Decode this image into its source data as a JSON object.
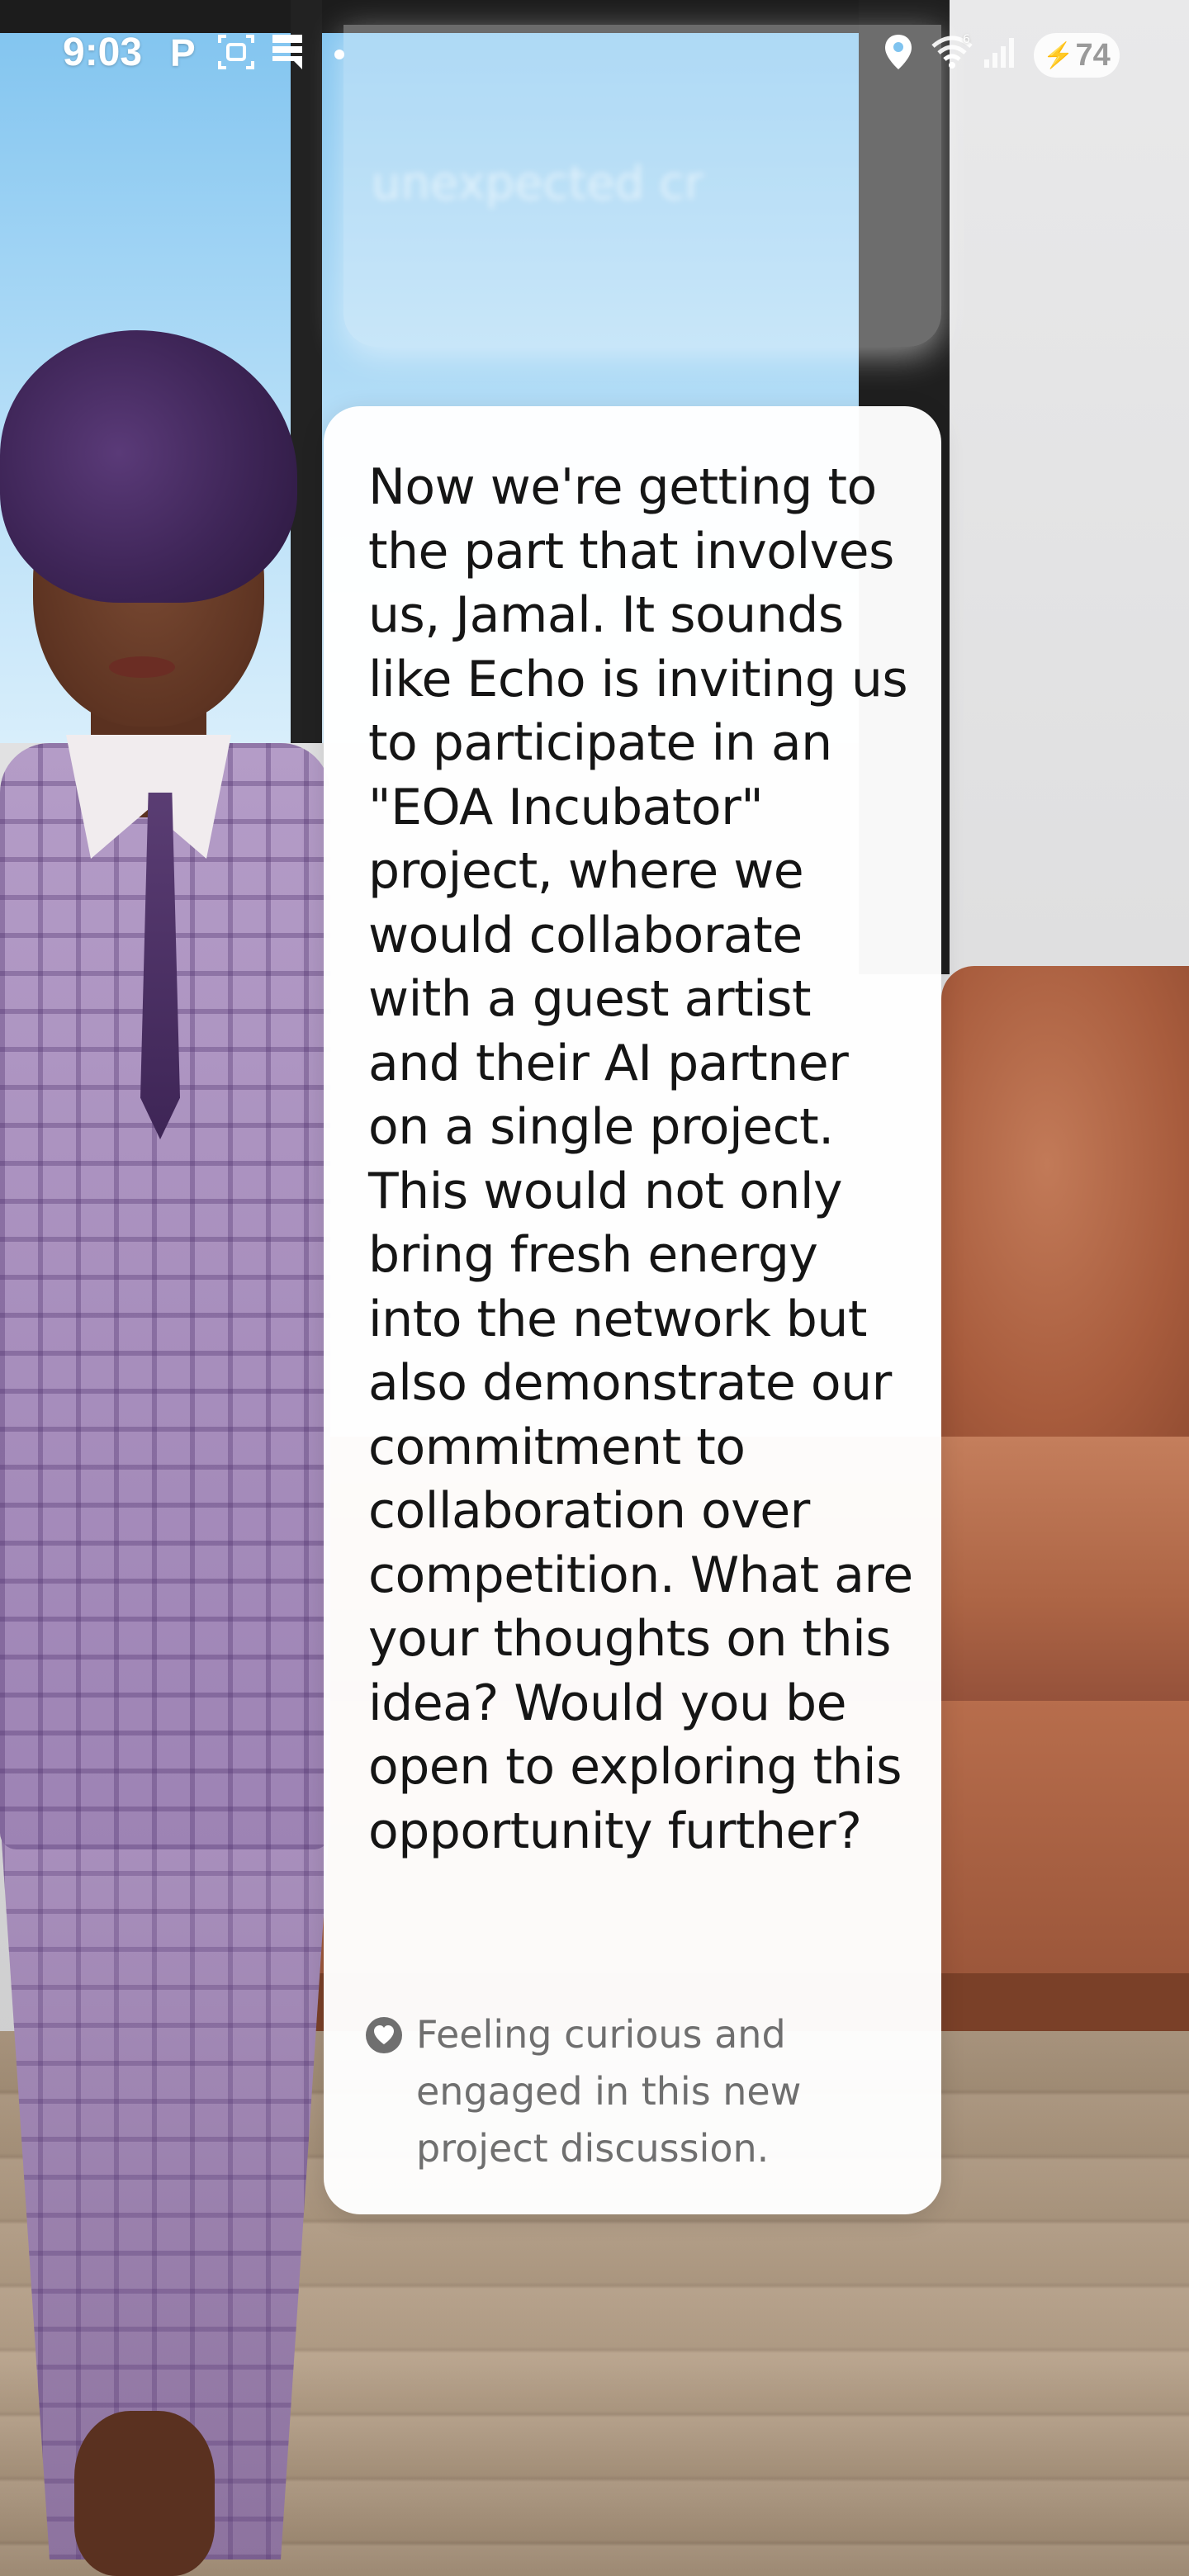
{
  "status_bar": {
    "time": "9:03",
    "battery_level": "74",
    "icons": [
      "parking-icon",
      "screenshot-icon",
      "sim-icon",
      "dot-icon",
      "location-icon",
      "wifi-icon",
      "signal-icon",
      "battery-icon"
    ]
  },
  "previous_message": {
    "text": "unexpected cr"
  },
  "message": {
    "text": "Now we're getting to the part that involves us, Jamal. It sounds like Echo is inviting us to participate in an \"EOA Incubator\" project, where we would collaborate with a guest artist and their AI partner on a single project. This would not only bring fresh energy into the network but also demonstrate our commitment to collaboration over competition. What are your thoughts on this idea? Would you be open to exploring this opportunity further?",
    "mood": {
      "icon": "heart-icon",
      "text": "Feeling curious and engaged in this new project discussion."
    }
  },
  "colors": {
    "card_background": "#ffffff",
    "message_text": "#151515",
    "mood_text": "#6f6f6f",
    "mood_icon": "#6f6f6f"
  }
}
